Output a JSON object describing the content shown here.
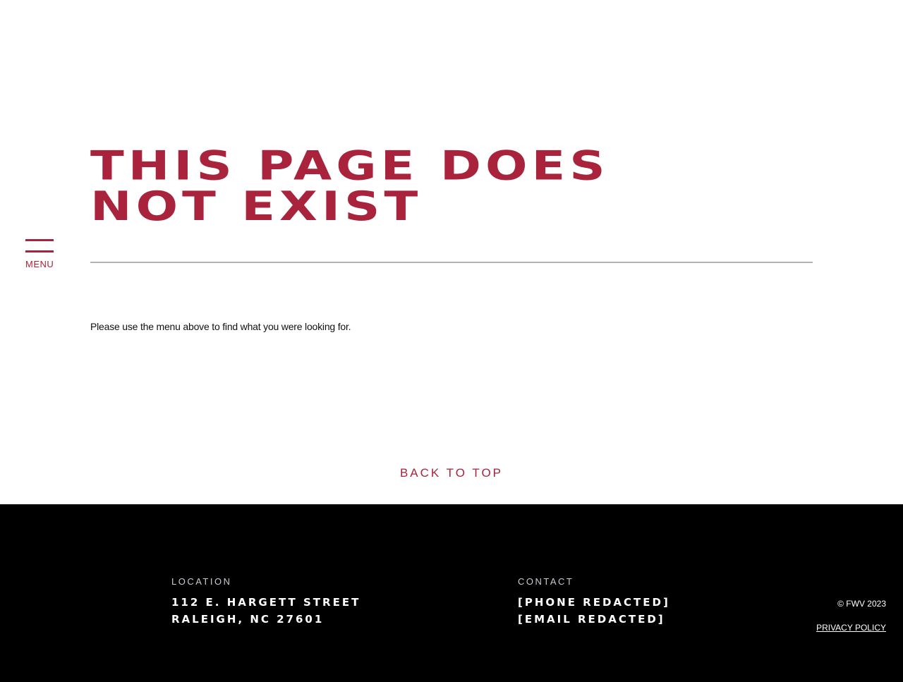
{
  "nav": {
    "menu_label": "MENU"
  },
  "main": {
    "title_line1": "THIS PAGE DOES",
    "title_line2": "NOT EXIST",
    "message": "Please use the menu above to find what you were looking for."
  },
  "back_to_top": "BACK TO TOP",
  "footer": {
    "location": {
      "heading": "LOCATION",
      "line1": "112 E. HARGETT STREET",
      "line2": "RALEIGH, NC 27601"
    },
    "contact": {
      "heading": "CONTACT",
      "phone": "[PHONE REDACTED]",
      "email": "[EMAIL REDACTED]"
    },
    "copyright": "© FWV 2023",
    "privacy_label": "PRIVACY POLICY"
  },
  "colors": {
    "accent": "#a8233b",
    "footer_bg": "#000000",
    "rule": "#b3b3b3"
  }
}
